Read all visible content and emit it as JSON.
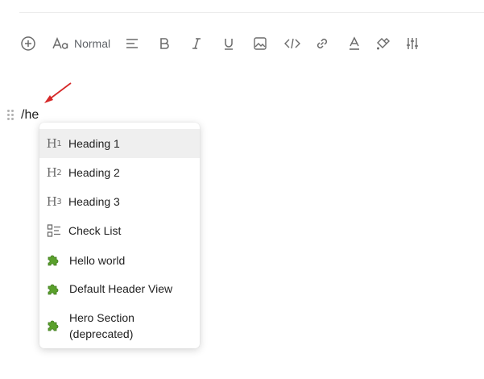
{
  "toolbar": {
    "font_style_value": "Normal",
    "icons": [
      "add-icon",
      "text-style-icon",
      "align-icon",
      "bold-icon",
      "italic-icon",
      "underline-icon",
      "image-icon",
      "code-icon",
      "link-icon",
      "text-color-icon",
      "highlight-icon",
      "sliders-icon"
    ]
  },
  "editor": {
    "typed_text": "/he"
  },
  "menu": {
    "items": [
      {
        "label": "Heading 1",
        "icon": "heading-1-icon"
      },
      {
        "label": "Heading 2",
        "icon": "heading-2-icon"
      },
      {
        "label": "Heading 3",
        "icon": "heading-3-icon"
      },
      {
        "label": "Check List",
        "icon": "checklist-icon"
      },
      {
        "label": "Hello world",
        "icon": "puzzle-icon"
      },
      {
        "label": "Default Header View",
        "icon": "puzzle-icon"
      },
      {
        "label": "Hero Section",
        "label2": "(deprecated)",
        "icon": "puzzle-icon"
      }
    ]
  },
  "colors": {
    "annotation_arrow": "#d62828",
    "active_item_bg": "#efefef",
    "icon_gray": "#6b6b6b",
    "puzzle_green": "#5aa02c"
  }
}
